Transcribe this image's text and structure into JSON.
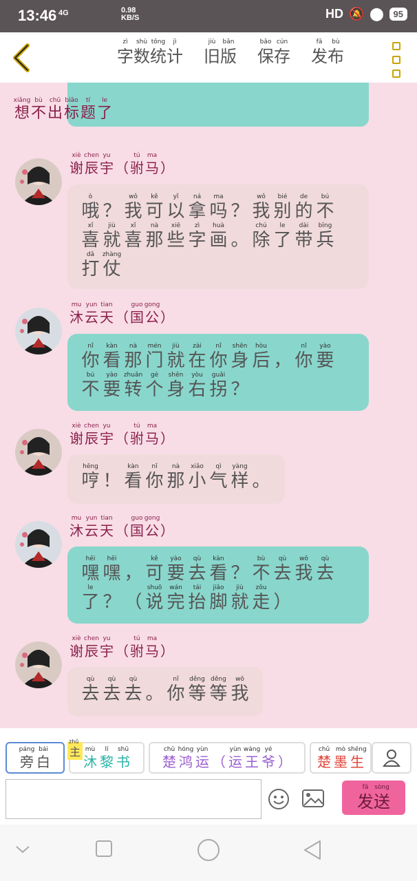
{
  "status_bar": {
    "time": "13:46",
    "network": "4G",
    "speed_value": "0.98",
    "speed_unit": "KB/S",
    "hd": "HD",
    "battery": "95"
  },
  "toolbar": {
    "menu": [
      {
        "label": "字数统计",
        "pinyin": [
          "zì",
          "shù",
          "tǒng",
          "jì"
        ]
      },
      {
        "label": "旧版",
        "pinyin": [
          "jiù",
          "bǎn"
        ]
      },
      {
        "label": "保存",
        "pinyin": [
          "bǎo",
          "cún"
        ]
      },
      {
        "label": "发布",
        "pinyin": [
          "fā",
          "bù"
        ]
      }
    ],
    "colors": {
      "kebab": "#c9a400"
    }
  },
  "chat": {
    "title": {
      "text": "想不出标题了",
      "pinyin": [
        "xiǎng",
        "bù",
        "chū",
        "biāo",
        "tí",
        "le"
      ]
    },
    "messages": [
      {
        "speaker": "谢辰宇（驸马）",
        "speaker_pinyin": [
          "xiè",
          "chen",
          "yu",
          "",
          "tú",
          "ma",
          ""
        ],
        "style": "pink",
        "lines": [
          {
            "text": "哦？我可以拿吗？我别的不",
            "pinyin": [
              "ò",
              "",
              "wǒ",
              "kě",
              "yǐ",
              "ná",
              "ma",
              "",
              "wǒ",
              "bié",
              "de",
              "bú"
            ]
          },
          {
            "text": "喜就喜那些字画。除了带兵",
            "pinyin": [
              "xǐ",
              "jiù",
              "xǐ",
              "nà",
              "xiē",
              "zì",
              "huà",
              "",
              "chú",
              "le",
              "dài",
              "bīng"
            ]
          },
          {
            "text": "打仗",
            "pinyin": [
              "dǎ",
              "zhàng"
            ]
          }
        ]
      },
      {
        "speaker": "沐云天（国公）",
        "speaker_pinyin": [
          "mu",
          "yun",
          "tian",
          "",
          "guo",
          "gong",
          ""
        ],
        "style": "teal",
        "lines": [
          {
            "text": "你看那门就在你身后，你要",
            "pinyin": [
              "nǐ",
              "kàn",
              "nà",
              "mén",
              "jiù",
              "zài",
              "nǐ",
              "shēn",
              "hòu",
              "",
              "nǐ",
              "yào"
            ]
          },
          {
            "text": "不要转个身右拐？",
            "pinyin": [
              "bú",
              "yào",
              "zhuǎn",
              "gè",
              "shēn",
              "yòu",
              "guǎi",
              ""
            ]
          }
        ]
      },
      {
        "speaker": "谢辰宇（驸马）",
        "speaker_pinyin": [
          "xiè",
          "chen",
          "yu",
          "",
          "tú",
          "ma",
          ""
        ],
        "style": "pink",
        "lines": [
          {
            "text": "哼！看你那小气样。",
            "pinyin": [
              "hēng",
              "",
              "kàn",
              "nǐ",
              "nà",
              "xiǎo",
              "qì",
              "yàng",
              ""
            ]
          }
        ]
      },
      {
        "speaker": "沐云天（国公）",
        "speaker_pinyin": [
          "mu",
          "yun",
          "tian",
          "",
          "guo",
          "gong",
          ""
        ],
        "style": "teal",
        "lines": [
          {
            "text": "嘿嘿，可要去看？不去我去",
            "pinyin": [
              "hēi",
              "hēi",
              "",
              "kě",
              "yào",
              "qù",
              "kàn",
              "",
              "bù",
              "qù",
              "wǒ",
              "qù"
            ]
          },
          {
            "text": "了？（说完抬脚就走）",
            "pinyin": [
              "le",
              "",
              "",
              "shuō",
              "wán",
              "tái",
              "jiǎo",
              "jiù",
              "zǒu",
              ""
            ]
          }
        ]
      },
      {
        "speaker": "谢辰宇（驸马）",
        "speaker_pinyin": [
          "xiè",
          "chen",
          "yu",
          "",
          "tú",
          "ma",
          ""
        ],
        "style": "pink",
        "lines": [
          {
            "text": "去去去。你等等我",
            "pinyin": [
              "qù",
              "qù",
              "qù",
              "",
              "nǐ",
              "děng",
              "děng",
              "wǒ"
            ]
          }
        ]
      }
    ],
    "colors": {
      "pink_bubble": "#f1dadc",
      "teal_bubble": "#89d6cc",
      "name": "#8a1f4a",
      "background": "#f8dde6"
    }
  },
  "composer": {
    "roles": [
      {
        "label": "旁白",
        "pinyin": [
          "páng",
          "bái"
        ],
        "color": "#555555"
      },
      {
        "label": "沐黎书",
        "pinyin": [
          "mù",
          "lí",
          "shū"
        ],
        "color": "#2bb3a6"
      },
      {
        "label": "楚鸿运（运王爷）",
        "pinyin": [
          "chǔ",
          "hóng",
          "yùn",
          "",
          "yùn",
          "wáng",
          "yé",
          ""
        ],
        "color": "#9b5fd0"
      },
      {
        "label": "楚墨生",
        "pinyin": [
          "chǔ",
          "mò",
          "shēng"
        ],
        "color": "#e0453a"
      }
    ],
    "main_tag": {
      "label": "主",
      "pinyin": "zhǔ"
    },
    "input_value": "",
    "send": {
      "label": "发送",
      "pinyin": [
        "fā",
        "sòng"
      ]
    }
  },
  "icons": [
    "back-chevron-icon",
    "kebab-menu-icon",
    "user-icon",
    "emoji-icon",
    "image-icon",
    "nav-back-icon",
    "nav-home-icon",
    "nav-recents-icon",
    "nav-collapse-icon"
  ]
}
